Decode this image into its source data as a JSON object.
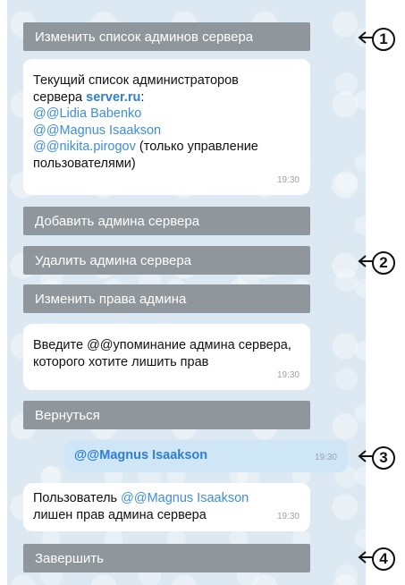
{
  "buttons": {
    "change_admins": "Изменить список админов сервера",
    "add_admin": "Добавить админа сервера",
    "remove_admin": "Удалить админа сервера",
    "change_rights": "Изменить права админа",
    "back": "Вернуться",
    "finish": "Завершить"
  },
  "msg1": {
    "line1": "Текущий список администраторов",
    "line2_prefix": "сервера ",
    "server": "server.ru",
    "line2_suffix": ":",
    "admin1": "@@Lidia Babenko",
    "admin2": "@@Magnus Isaakson",
    "admin3": "@@nikita.pirogov",
    "admin3_note": " (только управление",
    "admin3_note2": "пользователями)",
    "time": "19:30"
  },
  "msg2": {
    "line1": "Введите @@упоминание  админа сервера,",
    "line2": "которого хотите лишить прав",
    "time": "19:30"
  },
  "outgoing": {
    "text": "@@Magnus Isaakson",
    "time": "19:30"
  },
  "msg3": {
    "prefix": "Пользователь ",
    "mention": "@@Magnus Isaakson",
    "line2": "лишен прав админа сервера",
    "time": "19:30"
  },
  "callouts": [
    "1",
    "2",
    "3",
    "4"
  ]
}
